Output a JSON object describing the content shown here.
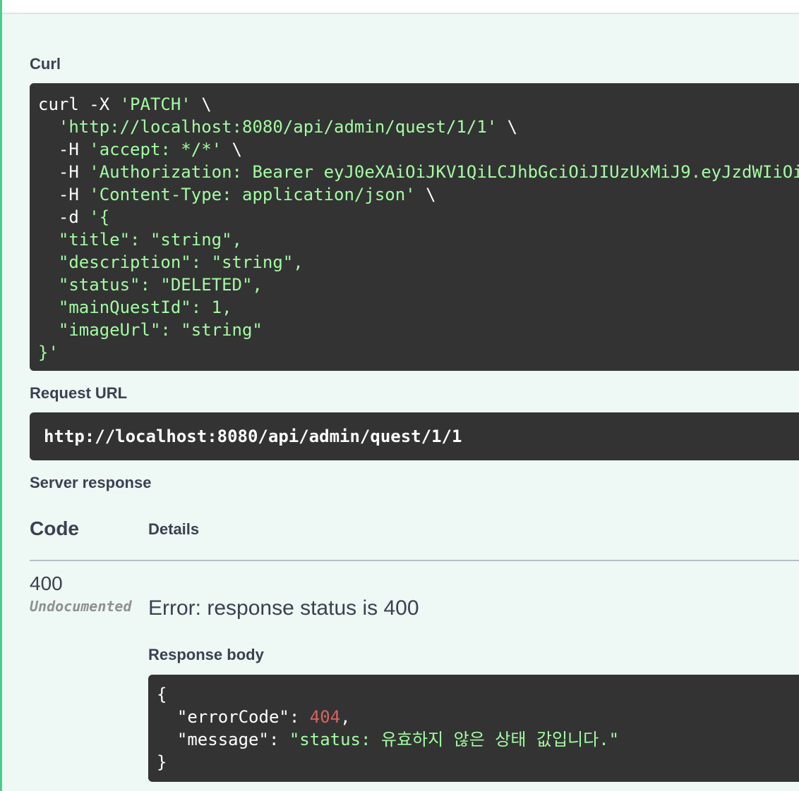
{
  "curl": {
    "label": "Curl",
    "lines": [
      [
        {
          "t": "curl -X ",
          "c": "plain"
        },
        {
          "t": "'PATCH'",
          "c": "str"
        },
        {
          "t": " \\",
          "c": "plain"
        }
      ],
      [
        {
          "t": "  ",
          "c": "plain"
        },
        {
          "t": "'http://localhost:8080/api/admin/quest/1/1'",
          "c": "str"
        },
        {
          "t": " \\",
          "c": "plain"
        }
      ],
      [
        {
          "t": "  -H ",
          "c": "plain"
        },
        {
          "t": "'accept: */*'",
          "c": "str"
        },
        {
          "t": " \\",
          "c": "plain"
        }
      ],
      [
        {
          "t": "  -H ",
          "c": "plain"
        },
        {
          "t": "'Authorization: Bearer eyJ0eXAiOiJKV1QiLCJhbGciOiJIUzUxMiJ9.eyJzdWIiOi",
          "c": "str"
        }
      ],
      [
        {
          "t": "  -H ",
          "c": "plain"
        },
        {
          "t": "'Content-Type: application/json'",
          "c": "str"
        },
        {
          "t": " \\",
          "c": "plain"
        }
      ],
      [
        {
          "t": "  -d ",
          "c": "plain"
        },
        {
          "t": "'{",
          "c": "str"
        }
      ],
      [
        {
          "t": "  \"title\": \"string\",",
          "c": "str"
        }
      ],
      [
        {
          "t": "  \"description\": \"string\",",
          "c": "str"
        }
      ],
      [
        {
          "t": "  \"status\": \"DELETED\",",
          "c": "str"
        }
      ],
      [
        {
          "t": "  \"mainQuestId\": 1,",
          "c": "str"
        }
      ],
      [
        {
          "t": "  \"imageUrl\": \"string\"",
          "c": "str"
        }
      ],
      [
        {
          "t": "}'",
          "c": "str"
        }
      ]
    ]
  },
  "request_url": {
    "label": "Request URL",
    "value": "http://localhost:8080/api/admin/quest/1/1"
  },
  "server_response": {
    "label": "Server response",
    "col_code": "Code",
    "col_details": "Details",
    "code": "400",
    "undocumented": "Undocumented",
    "error_message": "Error: response status is 400",
    "body_label": "Response body",
    "body_lines": [
      [
        {
          "t": "{",
          "c": "plain"
        }
      ],
      [
        {
          "t": "  \"errorCode\": ",
          "c": "plain"
        },
        {
          "t": "404",
          "c": "num"
        },
        {
          "t": ",",
          "c": "plain"
        }
      ],
      [
        {
          "t": "  \"message\": ",
          "c": "plain"
        },
        {
          "t": "\"status: 유효하지 않은 상태 값입니다.\"",
          "c": "str"
        }
      ],
      [
        {
          "t": "}",
          "c": "plain"
        }
      ]
    ]
  },
  "colors": {
    "accent": "#49cc90",
    "code_bg": "#333333",
    "string_green": "#a2fca2",
    "number_red": "#d36363",
    "text_dark": "#3b4151"
  }
}
